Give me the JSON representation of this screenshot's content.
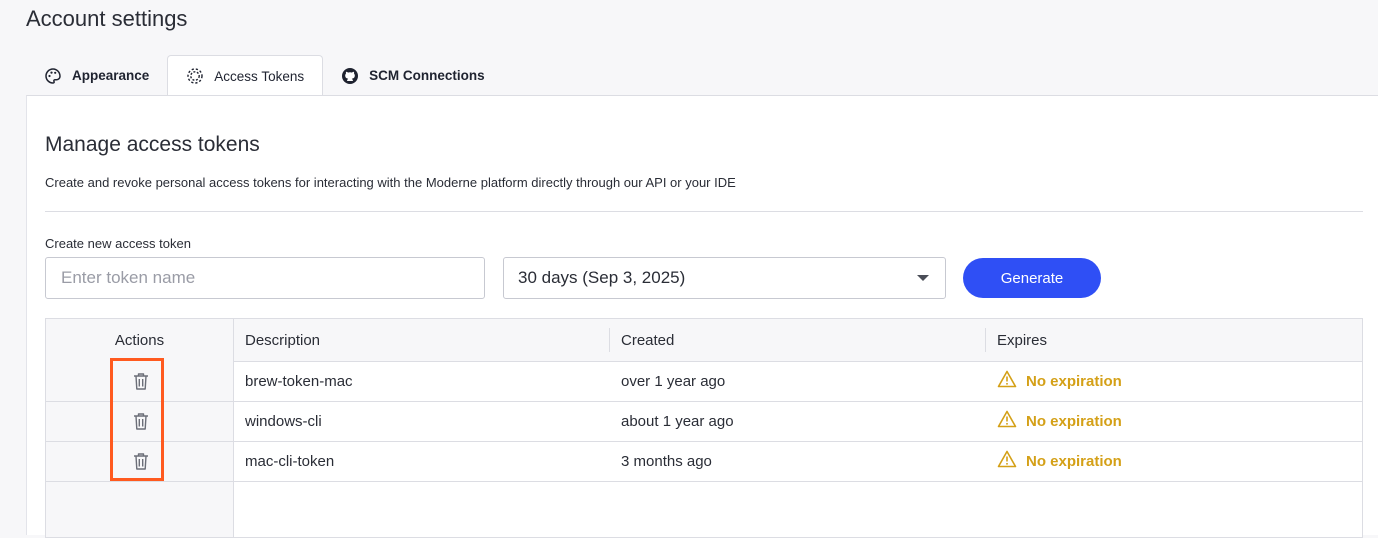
{
  "page": {
    "title": "Account settings"
  },
  "tabs": [
    {
      "label": "Appearance",
      "icon": "palette-icon"
    },
    {
      "label": "Access Tokens",
      "icon": "token-icon",
      "active": true
    },
    {
      "label": "SCM Connections",
      "icon": "github-icon"
    }
  ],
  "section": {
    "title": "Manage access tokens",
    "description": "Create and revoke personal access tokens for interacting with the Moderne platform directly through our API or your IDE"
  },
  "form": {
    "label": "Create new access token",
    "placeholder": "Enter token name",
    "value": "",
    "expiry_selected": "30 days (Sep 3, 2025)",
    "generate_label": "Generate"
  },
  "table": {
    "headers": {
      "actions": "Actions",
      "description": "Description",
      "created": "Created",
      "expires": "Expires"
    },
    "rows": [
      {
        "description": "brew-token-mac",
        "created": "over 1 year ago",
        "expires": "No expiration"
      },
      {
        "description": "windows-cli",
        "created": "about 1 year ago",
        "expires": "No expiration"
      },
      {
        "description": "mac-cli-token",
        "created": "3 months ago",
        "expires": "No expiration"
      }
    ]
  },
  "colors": {
    "accent": "#2f4ff5",
    "warning": "#d4a017",
    "highlight": "#ff5a1f"
  }
}
